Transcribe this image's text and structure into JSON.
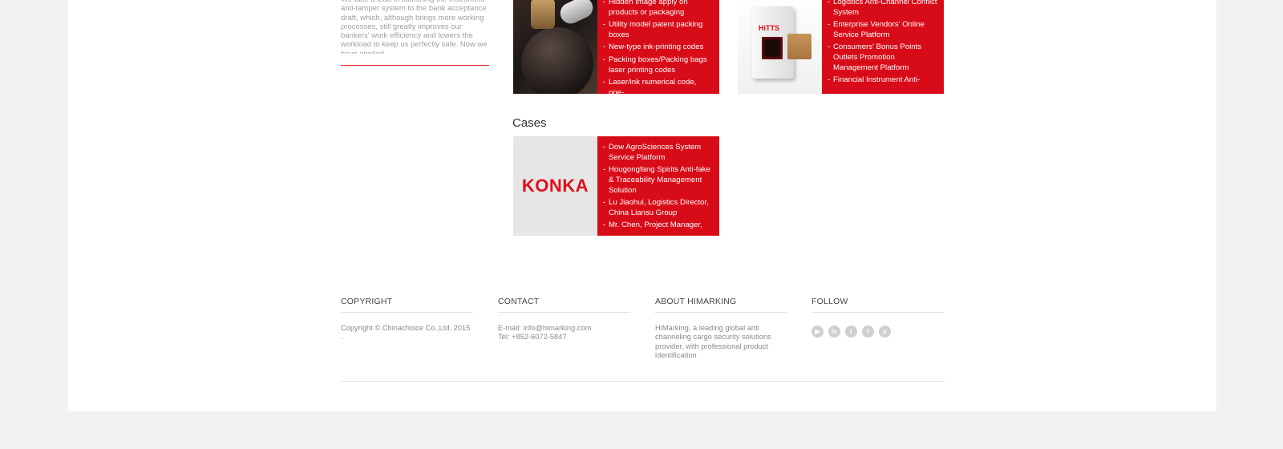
{
  "intro": {
    "text": "We take a lead in launching the instrument anti-tamper system to the bank acceptance draft, which, although brings more working processes, still greatly improves our bankers' work efficiency and lowers the workload to keep us perfectly safe. Now we have applied"
  },
  "products_left": {
    "items": [
      "Hidden Image apply on products or packaging",
      "Utility model patent packing boxes",
      "New-type ink-printing codes",
      "Packing boxes/Packing bags laser printing codes",
      "Laser/ink numerical code, one-"
    ]
  },
  "products_right": {
    "logo_text": "HiTTS",
    "items": [
      "Logistics Anti-Channel Conflict System",
      "Enterprise Vendors' Online Service Platform",
      "Consumers' Bonus Points Outlets Promotion Management Platform",
      "Financial Instrument Anti-"
    ]
  },
  "cases": {
    "title": "Cases",
    "logo_text": "KONKA",
    "items": [
      "Dow AgroSciences System Service Platform",
      "Hougongfang Spirits Anti-fake & Traceability Management Solution",
      "Lu Jiaohui, Logistics Director, China Liansu Group",
      "Mr. Chen, Project Manager,"
    ]
  },
  "footer": {
    "copyright": {
      "heading": "COPYRIGHT",
      "text": "Copyright © Chinachoice Co.,Ltd. 2015",
      "dot": "."
    },
    "contact": {
      "heading": "CONTACT",
      "email": "E-mail: info@himarking.com",
      "tel": "Tel: +852-6072-5847"
    },
    "about": {
      "heading": "ABOUT HIMARKING",
      "text": "HiMarking, a leading global anti channeling cargo security solutions provider, with professional product identification"
    },
    "follow": {
      "heading": "FOLLOW",
      "icons": [
        "youtube-icon",
        "linkedin-icon",
        "twitter-icon",
        "facebook-icon",
        "pinterest-icon"
      ]
    }
  },
  "colors": {
    "accent": "#d80c18",
    "page_bg": "#f2f2f2"
  }
}
